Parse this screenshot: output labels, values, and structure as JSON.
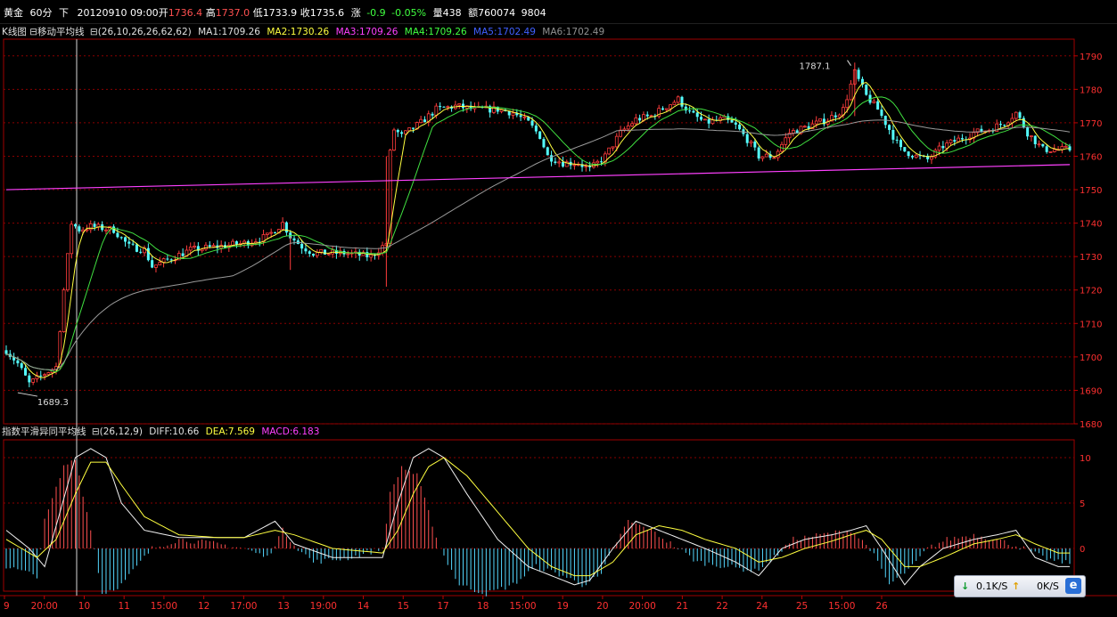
{
  "header": {
    "symbol": "黄金",
    "period": "60分",
    "direction": "下",
    "datetime": "20120910 09:00",
    "open_label": "开",
    "open": "1736.4",
    "high_label": "高",
    "high": "1737.0",
    "low_label": "低",
    "low": "1733.9",
    "close_label": "收",
    "close": "1735.6",
    "change_label": "涨",
    "change": "-0.9",
    "change_pct": "-0.05%",
    "volume_label": "量",
    "volume": "438",
    "amount_label": "额",
    "amount": "760074",
    "extra": "9804"
  },
  "ma_panel": {
    "label": "K线图",
    "indicator": "移动平均线",
    "params": "(26,10,26,26,62,62)",
    "items": [
      {
        "text": "MA1:1709.26",
        "color": "#e0e0e0"
      },
      {
        "text": "MA2:1730.26",
        "color": "#ffff40"
      },
      {
        "text": "MA3:1709.26",
        "color": "#ff40ff"
      },
      {
        "text": "MA4:1709.26",
        "color": "#40ff40"
      },
      {
        "text": "MA5:1702.49",
        "color": "#4060ff"
      },
      {
        "text": "MA6:1702.49",
        "color": "#909090"
      }
    ]
  },
  "macd_panel": {
    "indicator": "指数平滑异同平均线",
    "params": "(26,12,9)",
    "items": [
      {
        "text": "DIFF:10.66",
        "color": "#e0e0e0"
      },
      {
        "text": "DEA:7.569",
        "color": "#ffff40"
      },
      {
        "text": "MACD:6.183",
        "color": "#ff40ff"
      }
    ]
  },
  "status": {
    "down_rate": "0.1K/S",
    "up_rate": "0K/S"
  },
  "chart_data": [
    {
      "type": "candlestick",
      "title": "",
      "ylim": [
        1680,
        1795
      ],
      "yticks": [
        1680,
        1690,
        1700,
        1710,
        1720,
        1730,
        1740,
        1750,
        1760,
        1770,
        1780,
        1790
      ],
      "ytick_labels": [
        "1680",
        "1690",
        "1700",
        "1710",
        "1720",
        "1730",
        "1740",
        "1750",
        "1760",
        "1770",
        "1780",
        "1790"
      ],
      "xticks": [
        "9",
        "20:00",
        "10",
        "11",
        "15:00",
        "12",
        "17:00",
        "13",
        "19:00",
        "14",
        "15",
        "17",
        "18",
        "15:00",
        "19",
        "20",
        "20:00",
        "21",
        "22",
        "24",
        "25",
        "15:00",
        "26"
      ],
      "annotations": [
        {
          "text": "1689.3",
          "x_index": 3,
          "value": 1689.3
        },
        {
          "text": "1787.1",
          "x_index": 220,
          "value": 1787.1
        }
      ],
      "trendline": {
        "from": [
          0,
          1750
        ],
        "to": [
          277,
          1757.5
        ],
        "color": "#ff40ff"
      },
      "anchors": [
        [
          0,
          1702
        ],
        [
          3,
          1698
        ],
        [
          6,
          1692
        ],
        [
          10,
          1695
        ],
        [
          13,
          1697
        ],
        [
          15,
          1720
        ],
        [
          17,
          1740
        ],
        [
          19,
          1738
        ],
        [
          22,
          1739
        ],
        [
          28,
          1738
        ],
        [
          32,
          1733
        ],
        [
          36,
          1732
        ],
        [
          38,
          1727
        ],
        [
          42,
          1729
        ],
        [
          48,
          1732
        ],
        [
          55,
          1733
        ],
        [
          62,
          1734
        ],
        [
          68,
          1736
        ],
        [
          72,
          1740
        ],
        [
          74,
          1736
        ],
        [
          77,
          1733
        ],
        [
          80,
          1731
        ],
        [
          88,
          1731
        ],
        [
          95,
          1730
        ],
        [
          99,
          1734
        ],
        [
          100,
          1761
        ],
        [
          101,
          1768
        ],
        [
          103,
          1766
        ],
        [
          108,
          1770
        ],
        [
          112,
          1774
        ],
        [
          117,
          1775
        ],
        [
          122,
          1774
        ],
        [
          128,
          1774
        ],
        [
          132,
          1773
        ],
        [
          136,
          1770
        ],
        [
          139,
          1766
        ],
        [
          141,
          1760
        ],
        [
          145,
          1758
        ],
        [
          149,
          1758
        ],
        [
          152,
          1756
        ],
        [
          156,
          1760
        ],
        [
          160,
          1767
        ],
        [
          164,
          1771
        ],
        [
          168,
          1772
        ],
        [
          172,
          1775
        ],
        [
          175,
          1777
        ],
        [
          178,
          1773
        ],
        [
          182,
          1770
        ],
        [
          187,
          1771
        ],
        [
          190,
          1769
        ],
        [
          193,
          1765
        ],
        [
          196,
          1760
        ],
        [
          200,
          1760
        ],
        [
          204,
          1767
        ],
        [
          209,
          1769
        ],
        [
          214,
          1771
        ],
        [
          218,
          1774
        ],
        [
          221,
          1785
        ],
        [
          224,
          1778
        ],
        [
          227,
          1774
        ],
        [
          230,
          1768
        ],
        [
          233,
          1762
        ],
        [
          237,
          1760
        ],
        [
          240,
          1759
        ],
        [
          244,
          1763
        ],
        [
          248,
          1765
        ],
        [
          252,
          1767
        ],
        [
          256,
          1768
        ],
        [
          260,
          1770
        ],
        [
          263,
          1773
        ],
        [
          266,
          1767
        ],
        [
          270,
          1762
        ],
        [
          274,
          1762
        ]
      ],
      "note_values": "OHLC per bar derived from anchor path"
    },
    {
      "type": "bar",
      "title": "",
      "ylim": [
        -8,
        12
      ],
      "yticks": [
        0,
        5,
        10
      ],
      "ytick_labels": [
        "0",
        "5",
        "10"
      ],
      "macd_anchors": [
        [
          0,
          -2
        ],
        [
          8,
          -3
        ],
        [
          10,
          3
        ],
        [
          15,
          9
        ],
        [
          18,
          10
        ],
        [
          20,
          6
        ],
        [
          23,
          0
        ],
        [
          25,
          -5
        ],
        [
          30,
          -4
        ],
        [
          38,
          0
        ],
        [
          45,
          1
        ],
        [
          55,
          0.5
        ],
        [
          62,
          0
        ],
        [
          68,
          -1
        ],
        [
          72,
          2
        ],
        [
          76,
          0
        ],
        [
          80,
          -1.5
        ],
        [
          90,
          -1
        ],
        [
          98,
          0
        ],
        [
          100,
          6
        ],
        [
          103,
          9
        ],
        [
          107,
          8
        ],
        [
          110,
          4
        ],
        [
          113,
          0
        ],
        [
          118,
          -4
        ],
        [
          125,
          -5
        ],
        [
          132,
          -4
        ],
        [
          138,
          -2
        ],
        [
          145,
          -3
        ],
        [
          150,
          -4
        ],
        [
          155,
          -3
        ],
        [
          158,
          0
        ],
        [
          162,
          3
        ],
        [
          168,
          2
        ],
        [
          175,
          0
        ],
        [
          180,
          -1.5
        ],
        [
          188,
          -2
        ],
        [
          195,
          -2.5
        ],
        [
          200,
          -1
        ],
        [
          205,
          1
        ],
        [
          212,
          1.5
        ],
        [
          220,
          2
        ],
        [
          225,
          0
        ],
        [
          230,
          -4
        ],
        [
          236,
          -2
        ],
        [
          240,
          0
        ],
        [
          245,
          1
        ],
        [
          252,
          1.5
        ],
        [
          258,
          1
        ],
        [
          265,
          0
        ],
        [
          270,
          -1
        ],
        [
          274,
          -1.5
        ]
      ],
      "diff_anchors": [
        [
          0,
          2
        ],
        [
          6,
          0
        ],
        [
          10,
          -2
        ],
        [
          14,
          4
        ],
        [
          18,
          10
        ],
        [
          22,
          11
        ],
        [
          26,
          10
        ],
        [
          30,
          5
        ],
        [
          36,
          2
        ],
        [
          45,
          1.2
        ],
        [
          55,
          1.2
        ],
        [
          62,
          1.2
        ],
        [
          70,
          3
        ],
        [
          75,
          0.5
        ],
        [
          85,
          -1
        ],
        [
          98,
          -1
        ],
        [
          102,
          5
        ],
        [
          106,
          10
        ],
        [
          110,
          11
        ],
        [
          114,
          10
        ],
        [
          120,
          6
        ],
        [
          128,
          1
        ],
        [
          136,
          -2
        ],
        [
          142,
          -3
        ],
        [
          148,
          -4
        ],
        [
          152,
          -3.5
        ],
        [
          158,
          0
        ],
        [
          164,
          3
        ],
        [
          170,
          2
        ],
        [
          176,
          1
        ],
        [
          182,
          0
        ],
        [
          190,
          -1.5
        ],
        [
          196,
          -3
        ],
        [
          202,
          0
        ],
        [
          208,
          1
        ],
        [
          215,
          1.5
        ],
        [
          220,
          2
        ],
        [
          224,
          2.5
        ],
        [
          228,
          0
        ],
        [
          234,
          -4
        ],
        [
          238,
          -2
        ],
        [
          244,
          0
        ],
        [
          252,
          1
        ],
        [
          258,
          1.5
        ],
        [
          263,
          2
        ],
        [
          268,
          -1
        ],
        [
          274,
          -2
        ]
      ],
      "dea_anchors": [
        [
          0,
          1
        ],
        [
          8,
          -1
        ],
        [
          13,
          1
        ],
        [
          18,
          6
        ],
        [
          22,
          9.5
        ],
        [
          26,
          9.5
        ],
        [
          30,
          7
        ],
        [
          36,
          3.5
        ],
        [
          45,
          1.5
        ],
        [
          55,
          1.2
        ],
        [
          62,
          1.2
        ],
        [
          70,
          2
        ],
        [
          75,
          1.5
        ],
        [
          85,
          0
        ],
        [
          98,
          -0.5
        ],
        [
          102,
          2
        ],
        [
          106,
          6
        ],
        [
          110,
          9
        ],
        [
          114,
          10
        ],
        [
          120,
          8
        ],
        [
          128,
          4
        ],
        [
          136,
          0
        ],
        [
          142,
          -2
        ],
        [
          148,
          -3
        ],
        [
          152,
          -3
        ],
        [
          158,
          -1.5
        ],
        [
          164,
          1.5
        ],
        [
          170,
          2.5
        ],
        [
          176,
          2
        ],
        [
          182,
          1
        ],
        [
          190,
          0
        ],
        [
          196,
          -1.5
        ],
        [
          202,
          -1
        ],
        [
          208,
          0
        ],
        [
          215,
          0.8
        ],
        [
          220,
          1.5
        ],
        [
          224,
          2
        ],
        [
          228,
          1
        ],
        [
          234,
          -2
        ],
        [
          238,
          -2
        ],
        [
          244,
          -1
        ],
        [
          252,
          0.5
        ],
        [
          258,
          1
        ],
        [
          263,
          1.5
        ],
        [
          268,
          0.5
        ],
        [
          274,
          -0.5
        ]
      ]
    }
  ]
}
